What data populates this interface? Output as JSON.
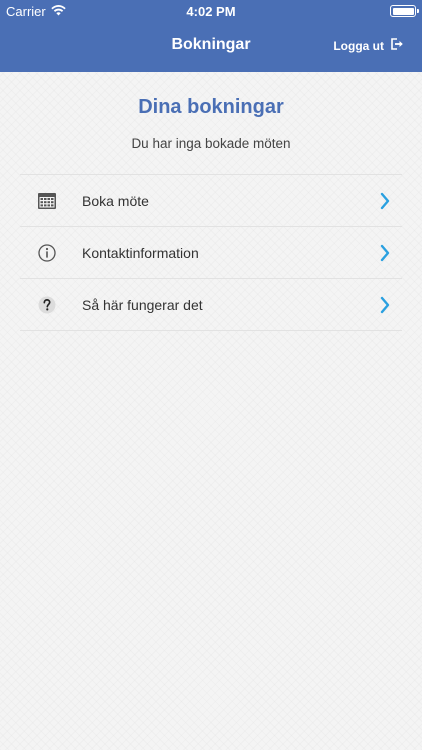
{
  "status": {
    "carrier": "Carrier",
    "time": "4:02 PM"
  },
  "navbar": {
    "title": "Bokningar",
    "logout_label": "Logga ut"
  },
  "main": {
    "heading": "Dina bokningar",
    "subheading": "Du har inga bokade möten"
  },
  "menu": {
    "items": [
      {
        "label": "Boka möte",
        "icon": "calendar-icon"
      },
      {
        "label": "Kontaktinformation",
        "icon": "info-icon"
      },
      {
        "label": "Så här fungerar det",
        "icon": "question-icon"
      }
    ]
  },
  "colors": {
    "brand": "#4a6fb5",
    "chevron": "#2aa0e0",
    "divider": "#e2e2e2",
    "background": "#f4f4f4"
  }
}
